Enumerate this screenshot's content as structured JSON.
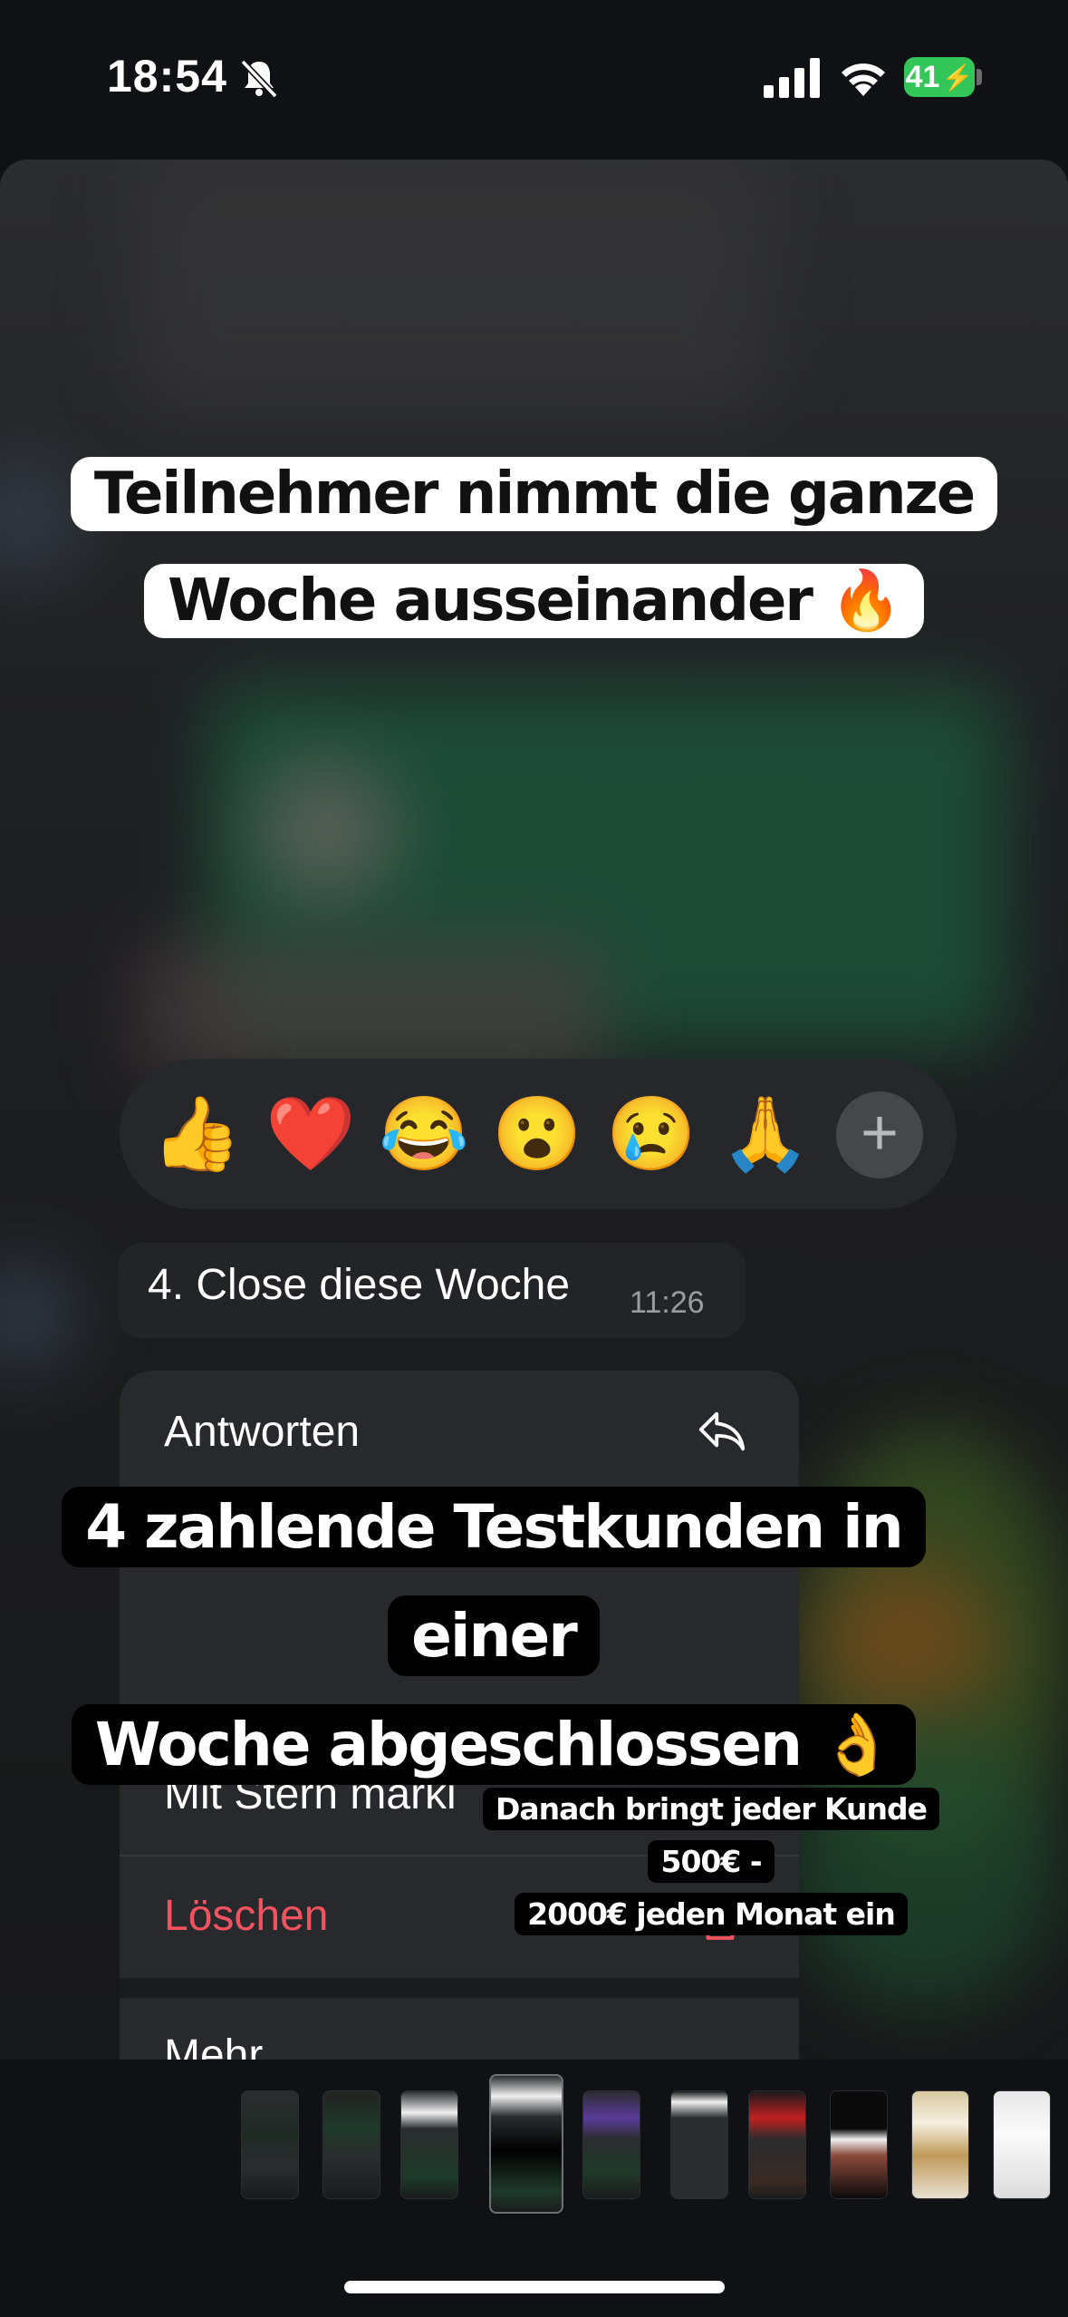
{
  "status_bar": {
    "time": "18:54",
    "battery": "41",
    "icons": [
      "bell-slash-icon",
      "cellular-signal-icon",
      "wifi-icon",
      "battery-charging-icon"
    ]
  },
  "caption_top": {
    "line1": "Teilnehmer nimmt die ganze",
    "line2": "Woche ausseinander 🔥"
  },
  "reactions": [
    "👍",
    "❤️",
    "😂",
    "😮",
    "😢",
    "🙏"
  ],
  "message": {
    "text": "4. Close diese Woche",
    "time": "11:26"
  },
  "menu": {
    "reply": "Antworten",
    "star": "Mit Stern marki",
    "delete": "Löschen",
    "more": "Mehr"
  },
  "caption_mid": {
    "line1": "4 zahlende Testkunden in einer",
    "line2": "Woche abgeschlossen 👌"
  },
  "caption_small": {
    "line1": "Danach bringt jeder Kunde 500€ -",
    "line2": "2000€ jeden Monat ein"
  },
  "colors": {
    "delete_red": "#f4525f",
    "battery_green": "#33c759"
  }
}
